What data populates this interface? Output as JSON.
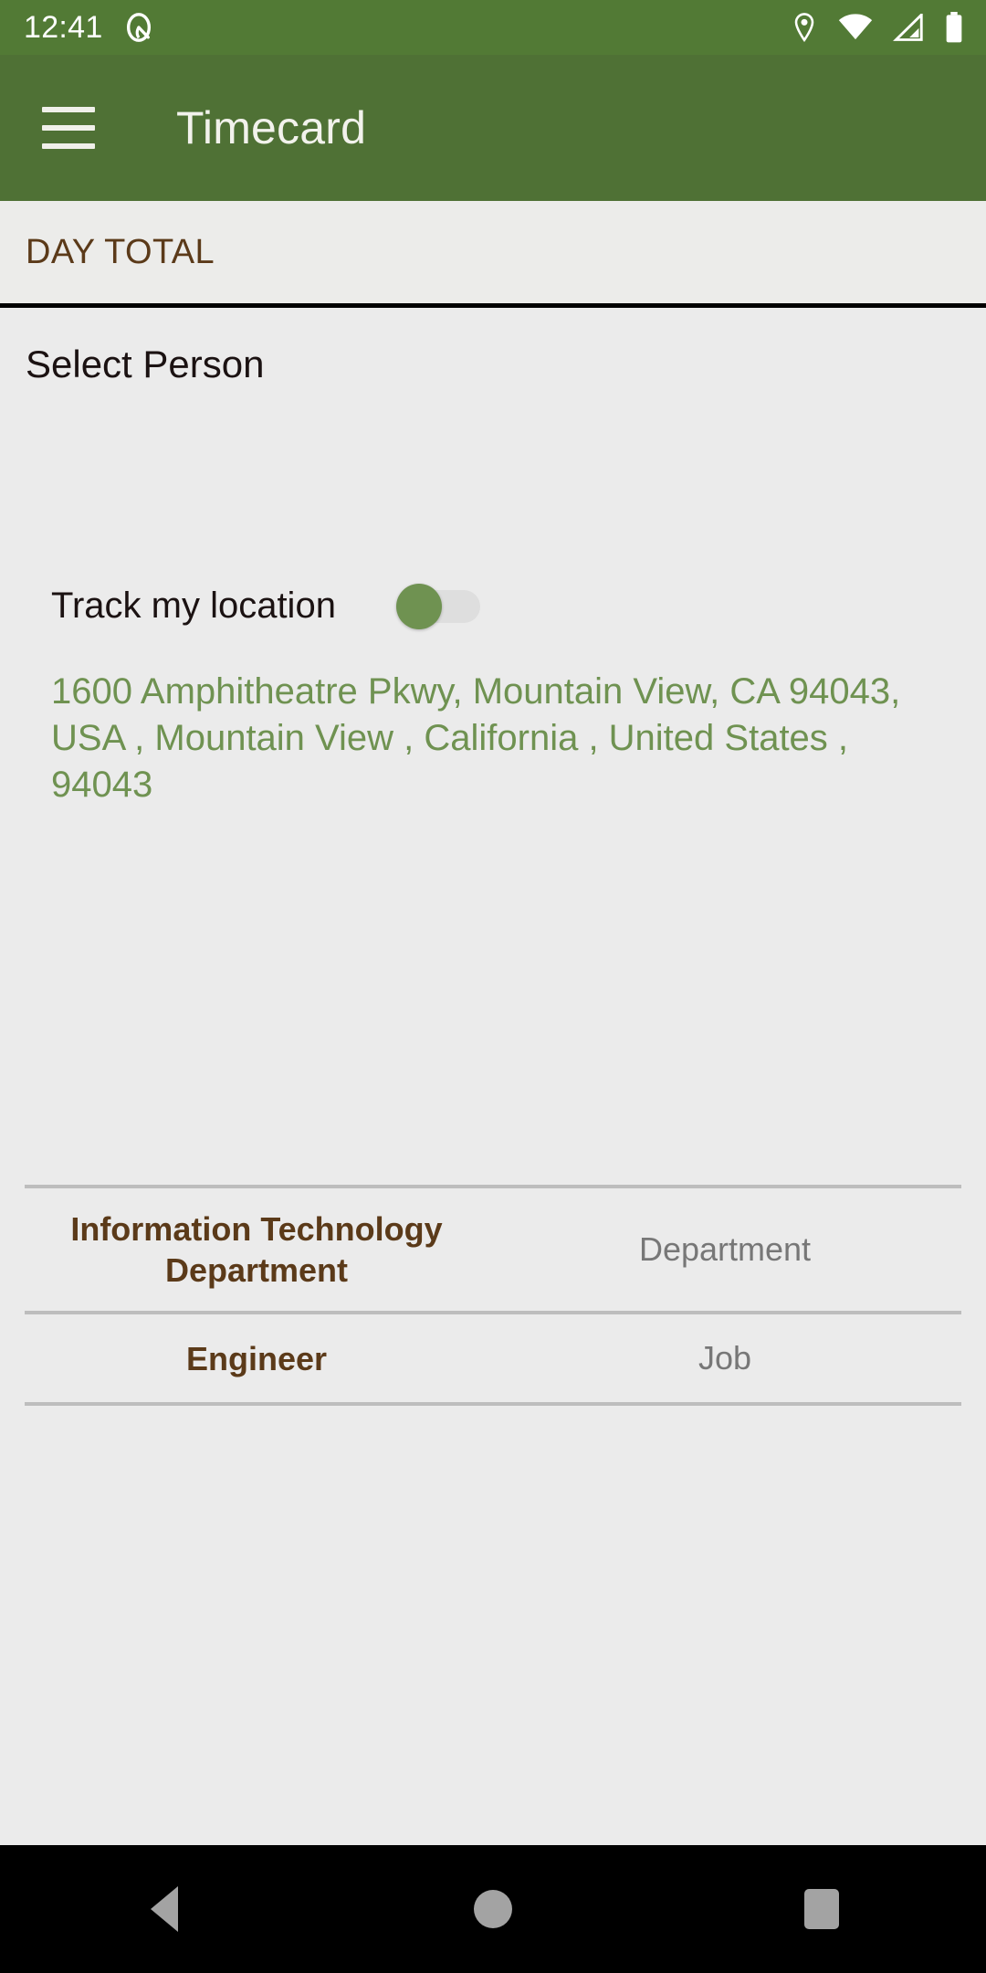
{
  "status_bar": {
    "clock": "12:41",
    "left_icons": [
      "screenshot-capture-icon"
    ],
    "right_icons": [
      "location-pin-icon",
      "wifi-icon",
      "cellular-signal-icon",
      "battery-icon"
    ],
    "background_color": "#527a35",
    "icon_color": "#ffffff"
  },
  "app_bar": {
    "menu_icon": "hamburger-menu-icon",
    "title": "Timecard",
    "background_color": "#4f7135",
    "text_color": "#f2f2ec"
  },
  "day_total": {
    "label": "DAY TOTAL",
    "text_color": "#5b3a19"
  },
  "select_person": {
    "label": "Select Person",
    "text_color": "#1b1212"
  },
  "track_location": {
    "label": "Track my location",
    "switch_state": "off",
    "thumb_color": "#6f9251",
    "track_color": "#dedede"
  },
  "address": {
    "text": "1600 Amphitheatre Pkwy, Mountain View, CA 94043, USA , Mountain View , California , United States , 94043",
    "text_color": "#6f9251"
  },
  "details": {
    "rows": [
      {
        "value": "Information Technology Department",
        "key": "Department"
      },
      {
        "value": "Engineer",
        "key": "Job"
      }
    ],
    "value_color": "#5b3a19",
    "key_color": "#777777",
    "divider_color": "#bdbdbd"
  },
  "nav_bar": {
    "back_label": "Back",
    "home_label": "Home",
    "recents_label": "Recents",
    "background_color": "#000000",
    "icon_color": "#a3a3a3"
  },
  "page": {
    "background_color": "#ebebeb"
  }
}
